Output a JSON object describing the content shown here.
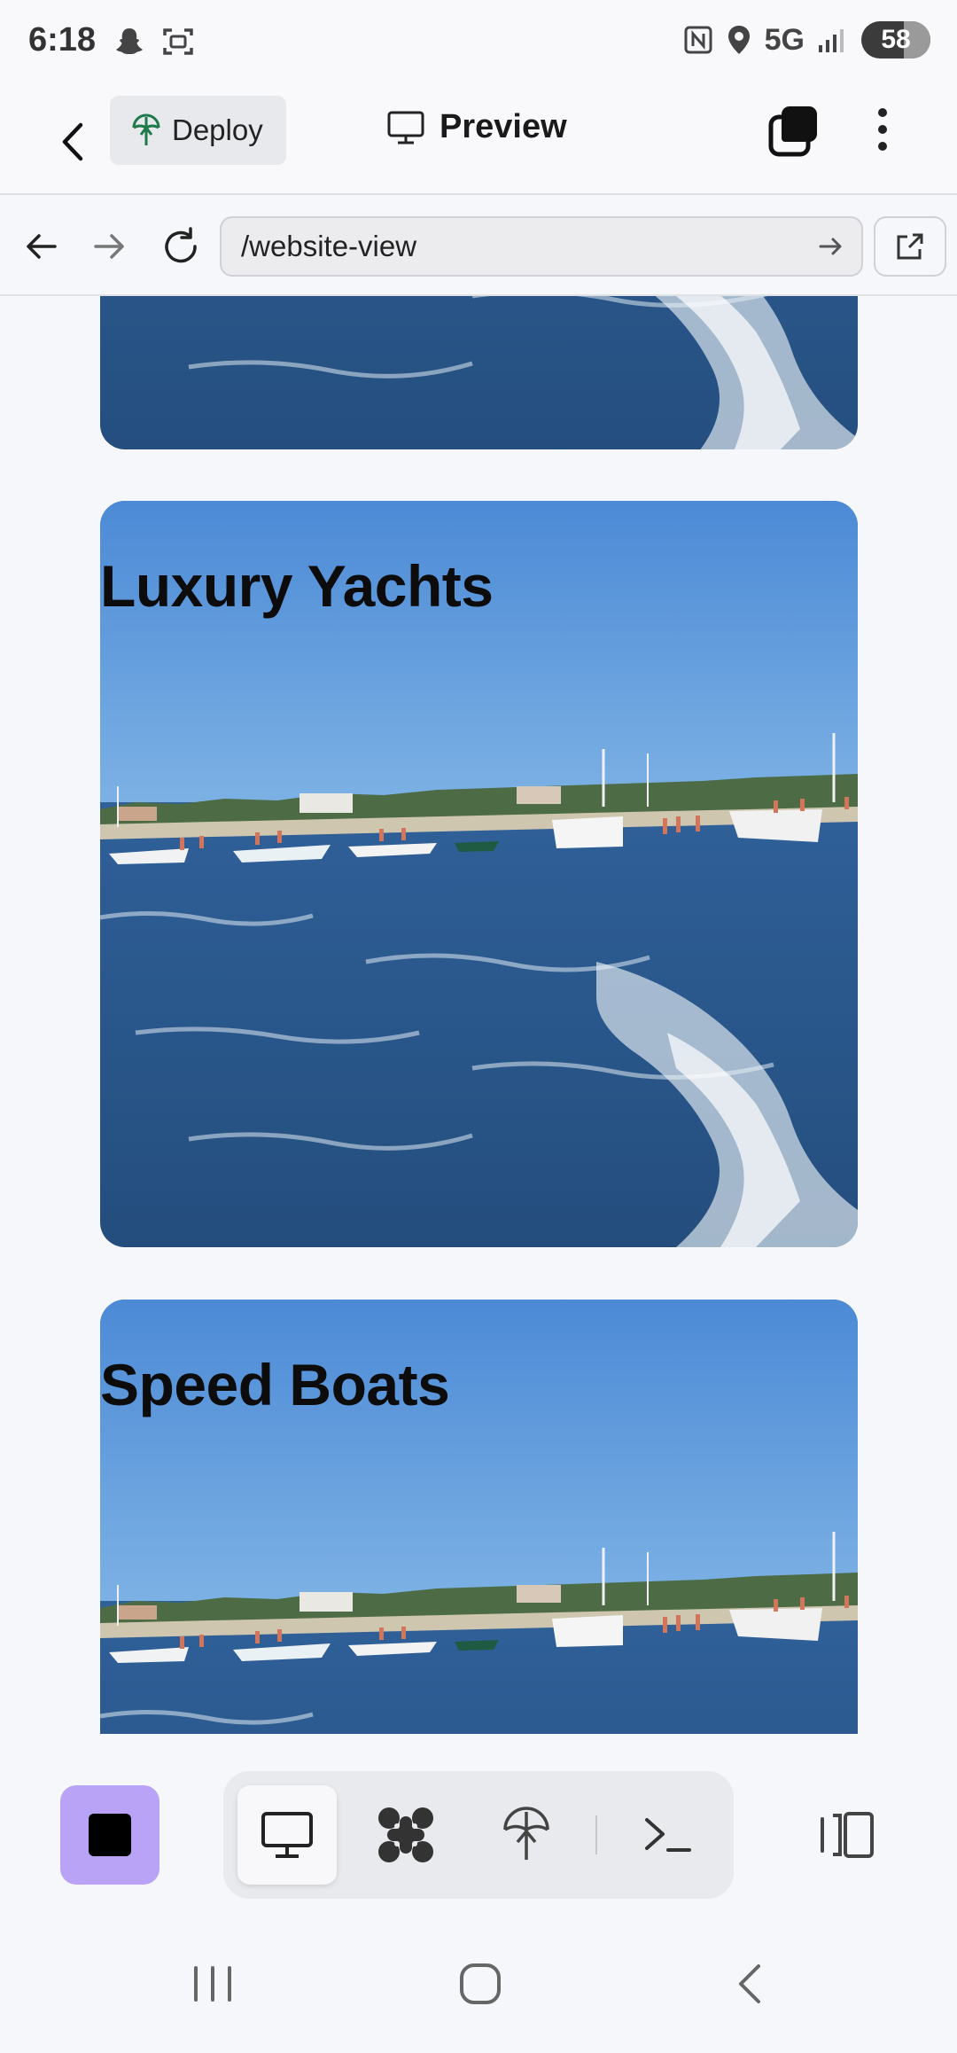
{
  "status_bar": {
    "time": "6:18",
    "network": "5G",
    "battery": "58",
    "icons": [
      "snapchat-icon",
      "screenshot-icon",
      "nfc-icon",
      "location-icon",
      "signal-icon",
      "battery-charging-icon"
    ]
  },
  "header": {
    "deploy_label": "Deploy",
    "title": "Preview"
  },
  "browser": {
    "url": "/website-view"
  },
  "cards": [
    {
      "title": ""
    },
    {
      "title": "Luxury Yachts"
    },
    {
      "title": "Speed Boats"
    }
  ],
  "toolbar": {
    "active_tab": "preview",
    "tabs": [
      "preview-icon",
      "workflow-icon",
      "deploy-icon",
      "console-icon"
    ]
  },
  "colors": {
    "accent": "#b9a3f7",
    "sky_top": "#4f8fd6",
    "sea": "#2c5f97"
  }
}
